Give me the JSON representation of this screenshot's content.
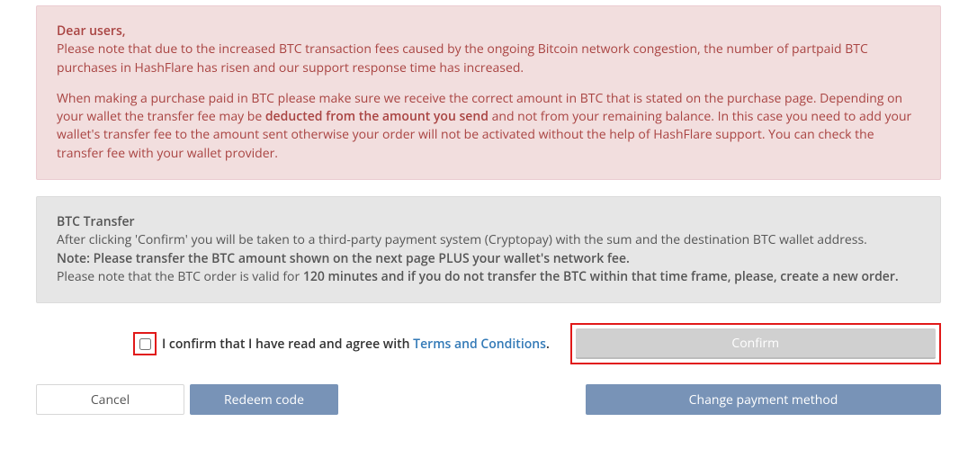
{
  "alert": {
    "salutation": "Dear users,",
    "p1": "Please note that due to the increased BTC transaction fees caused by the ongoing Bitcoin network congestion, the number of partpaid BTC purchases in HashFlare has risen and our support response time has increased.",
    "p2_pre": "When making a purchase paid in BTC please make sure we receive the correct amount in BTC that is stated on the purchase page. Depending on your wallet the transfer fee may be ",
    "p2_bold": "deducted from the amount you send",
    "p2_post": " and not from your remaining balance. In this case you need to add your wallet's transfer fee to the amount sent otherwise your order will not be activated without the help of HashFlare support. You can check the transfer fee with your wallet provider."
  },
  "info": {
    "title": "BTC Transfer",
    "line1": "After clicking 'Confirm' you will be taken to a third-party payment system (Cryptopay) with the sum and the destination BTC wallet address.",
    "line2_pre": "Note: ",
    "line2_bold": "Please transfer the BTC amount shown on the next page PLUS your wallet's network fee.",
    "line3_pre": "Please note that the BTC order is valid for ",
    "line3_bold": "120 minutes and if you do not transfer the BTC within that time frame, please, create a new order."
  },
  "terms": {
    "text_pre": "I confirm that I have read and agree with ",
    "link": "Terms and Conditions",
    "text_post": "."
  },
  "buttons": {
    "confirm": "Confirm",
    "cancel": "Cancel",
    "redeem": "Redeem code",
    "change": "Change payment method"
  }
}
